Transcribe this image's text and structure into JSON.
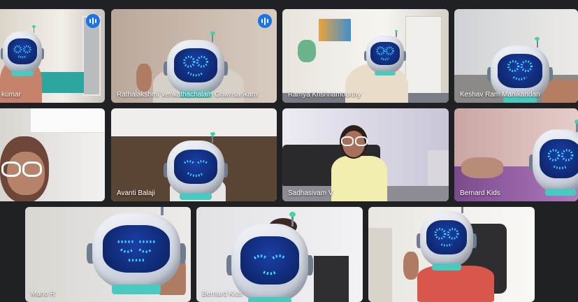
{
  "participants": [
    {
      "name": "kumar",
      "speaking": false,
      "audio": true
    },
    {
      "name": "Rathalakshmi Venkathachalam Gowrisankarn",
      "speaking": true,
      "audio": true
    },
    {
      "name": "Ramya Krishnamoorthy",
      "speaking": false,
      "audio": false
    },
    {
      "name": "Keshav Ram Manikandan",
      "speaking": false,
      "audio": false
    },
    {
      "name": "",
      "speaking": false,
      "audio": false
    },
    {
      "name": "Avanti Balaji",
      "speaking": false,
      "audio": false
    },
    {
      "name": "Sadhasivam V",
      "speaking": false,
      "audio": false
    },
    {
      "name": "Bernard Kids",
      "speaking": false,
      "audio": false
    },
    {
      "name": "Mano R",
      "speaking": false,
      "audio": false
    },
    {
      "name": "Bernard Kids",
      "speaking": false,
      "audio": false
    },
    {
      "name": "",
      "speaking": false,
      "audio": false
    }
  ],
  "icons": {
    "audio_indicator": "audio-level-icon",
    "face_filter": "robot-helmet-icon"
  },
  "colors": {
    "background": "#202124",
    "speaking_outline": "#8ab4f8",
    "audio_badge": "#1a73e8",
    "robot_visor": "#0b1f5a",
    "robot_face": "#3fe0ff"
  }
}
